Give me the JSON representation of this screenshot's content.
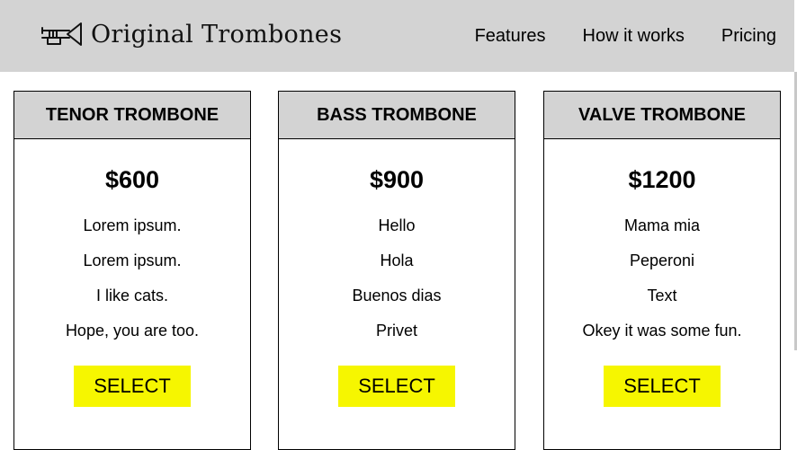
{
  "header": {
    "brand": "Original Trombones",
    "logo_icon": "trombone-icon",
    "nav": [
      {
        "label": "Features"
      },
      {
        "label": "How it works"
      },
      {
        "label": "Pricing"
      }
    ]
  },
  "colors": {
    "header_bg": "#d3d3d3",
    "button_bg": "#f6f600"
  },
  "plans": [
    {
      "title": "TENOR TROMBONE",
      "price": "$600",
      "features": [
        "Lorem ipsum.",
        "Lorem ipsum.",
        "I like cats.",
        "Hope, you are too."
      ],
      "button_label": "SELECT"
    },
    {
      "title": "BASS TROMBONE",
      "price": "$900",
      "features": [
        "Hello",
        "Hola",
        "Buenos dias",
        "Privet"
      ],
      "button_label": "SELECT"
    },
    {
      "title": "VALVE TROMBONE",
      "price": "$1200",
      "features": [
        "Mama mia",
        "Peperoni",
        "Text",
        "Okey it was some fun."
      ],
      "button_label": "SELECT"
    }
  ]
}
